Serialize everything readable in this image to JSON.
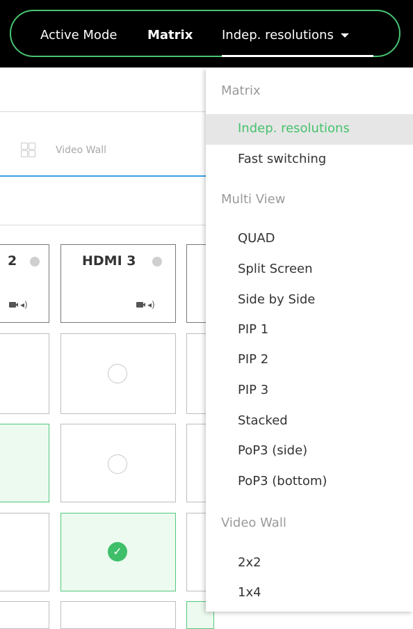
{
  "topbar": {
    "active_mode_label": "Active Mode",
    "current_mode": "Matrix",
    "dropdown_value": "Indep. resolutions"
  },
  "background": {
    "tab_video_wall": "Video Wall",
    "inputs": [
      {
        "name": "2"
      },
      {
        "name": "HDMI 3"
      }
    ],
    "check_glyph": "✓"
  },
  "menu": {
    "groups": [
      {
        "header": "Matrix",
        "items": [
          "Indep. resolutions",
          "Fast switching"
        ]
      },
      {
        "header": "Multi View",
        "items": [
          "QUAD",
          "Split Screen",
          "Side by Side",
          "PIP 1",
          "PIP 2",
          "PIP 3",
          "Stacked",
          "PoP3 (side)",
          "PoP3 (bottom)"
        ]
      },
      {
        "header": "Video Wall",
        "items": [
          "2x2",
          "1x4"
        ]
      }
    ],
    "selected": "Indep. resolutions"
  },
  "colors": {
    "accent_green": "#46c572",
    "tab_underline_blue": "#3aa0e8",
    "topbar_bg": "#000000"
  }
}
